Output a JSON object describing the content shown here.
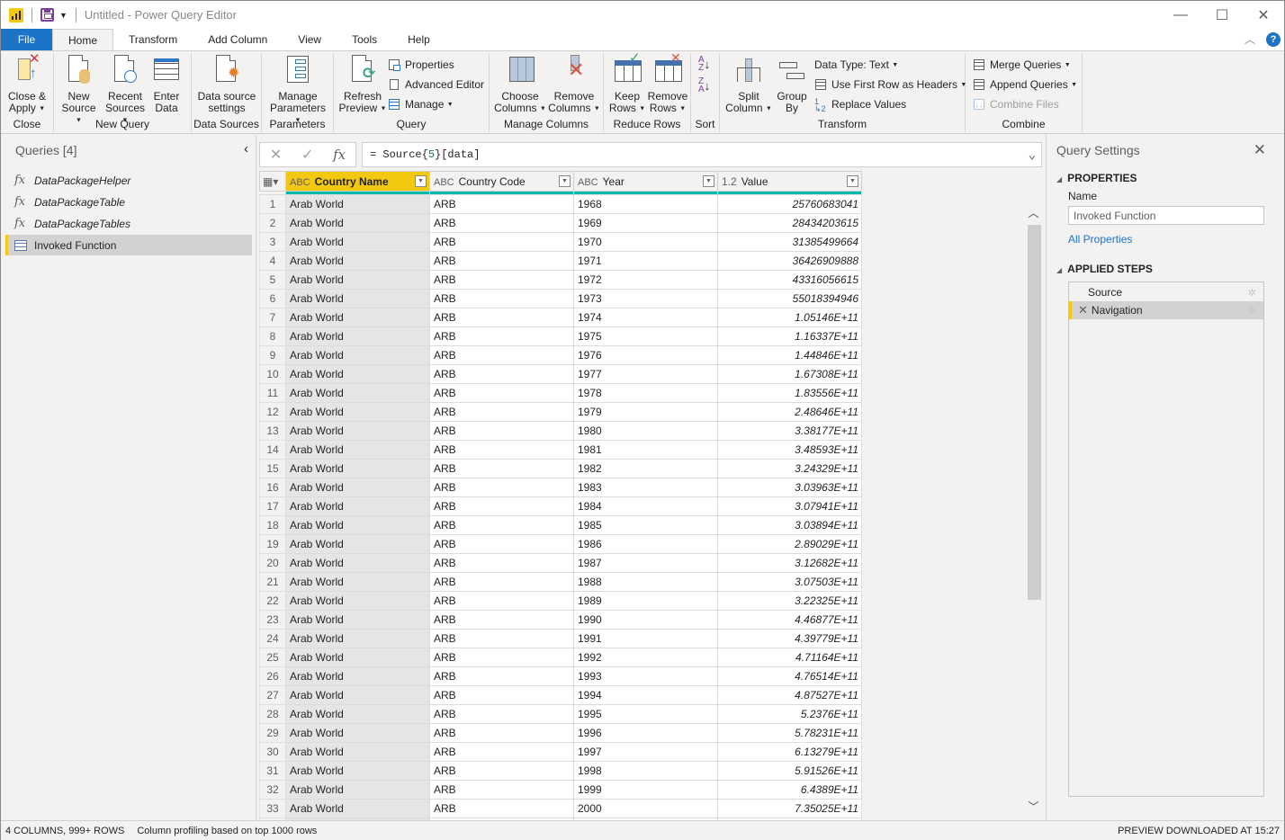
{
  "window": {
    "title": "Untitled - Power Query Editor",
    "app_icon": "powerbi-icon",
    "controls": {
      "minimize": "—",
      "maximize": "☐",
      "close": "✕"
    }
  },
  "tabs": [
    {
      "label": "File"
    },
    {
      "label": "Home",
      "active": true
    },
    {
      "label": "Transform"
    },
    {
      "label": "Add Column"
    },
    {
      "label": "View"
    },
    {
      "label": "Tools"
    },
    {
      "label": "Help"
    }
  ],
  "ribbon": {
    "close": {
      "label": "Close",
      "close_apply": [
        "Close &",
        "Apply"
      ]
    },
    "new_query": {
      "label": "New Query",
      "new_source": [
        "New",
        "Source"
      ],
      "recent_sources": [
        "Recent",
        "Sources"
      ],
      "enter_data": [
        "Enter",
        "Data"
      ]
    },
    "data_sources": {
      "label": "Data Sources",
      "settings": [
        "Data source",
        "settings"
      ]
    },
    "parameters": {
      "label": "Parameters",
      "manage": [
        "Manage",
        "Parameters"
      ]
    },
    "query": {
      "label": "Query",
      "refresh": [
        "Refresh",
        "Preview"
      ],
      "properties": "Properties",
      "advanced_editor": "Advanced Editor",
      "manage": "Manage"
    },
    "manage_columns": {
      "label": "Manage Columns",
      "choose": [
        "Choose",
        "Columns"
      ],
      "remove": [
        "Remove",
        "Columns"
      ]
    },
    "reduce_rows": {
      "label": "Reduce Rows",
      "keep": [
        "Keep",
        "Rows"
      ],
      "remove": [
        "Remove",
        "Rows"
      ]
    },
    "sort": {
      "label": "Sort"
    },
    "transform": {
      "label": "Transform",
      "split": [
        "Split",
        "Column"
      ],
      "group": [
        "Group",
        "By"
      ],
      "data_type": "Data Type: Text",
      "first_row": "Use First Row as Headers",
      "replace": "Replace Values"
    },
    "combine": {
      "label": "Combine",
      "merge": "Merge Queries",
      "append": "Append Queries",
      "combine_files": "Combine Files"
    }
  },
  "queries": {
    "title": "Queries [4]",
    "items": [
      {
        "label": "DataPackageHelper",
        "type": "function"
      },
      {
        "label": "DataPackageTable",
        "type": "function"
      },
      {
        "label": "DataPackageTables",
        "type": "function"
      },
      {
        "label": "Invoked Function",
        "type": "table",
        "selected": true
      }
    ]
  },
  "formula": {
    "prefix": "= Source{",
    "index": "5",
    "suffix": "}[data]"
  },
  "grid": {
    "columns": [
      {
        "type": "ABC",
        "name": "Country Name",
        "selected": true
      },
      {
        "type": "ABC",
        "name": "Country Code"
      },
      {
        "type": "ABC",
        "name": "Year"
      },
      {
        "type": "1.2",
        "name": "Value"
      }
    ],
    "rows": [
      [
        "Arab World",
        "ARB",
        "1968",
        "25760683041"
      ],
      [
        "Arab World",
        "ARB",
        "1969",
        "28434203615"
      ],
      [
        "Arab World",
        "ARB",
        "1970",
        "31385499664"
      ],
      [
        "Arab World",
        "ARB",
        "1971",
        "36426909888"
      ],
      [
        "Arab World",
        "ARB",
        "1972",
        "43316056615"
      ],
      [
        "Arab World",
        "ARB",
        "1973",
        "55018394946"
      ],
      [
        "Arab World",
        "ARB",
        "1974",
        "1.05146E+11"
      ],
      [
        "Arab World",
        "ARB",
        "1975",
        "1.16337E+11"
      ],
      [
        "Arab World",
        "ARB",
        "1976",
        "1.44846E+11"
      ],
      [
        "Arab World",
        "ARB",
        "1977",
        "1.67308E+11"
      ],
      [
        "Arab World",
        "ARB",
        "1978",
        "1.83556E+11"
      ],
      [
        "Arab World",
        "ARB",
        "1979",
        "2.48646E+11"
      ],
      [
        "Arab World",
        "ARB",
        "1980",
        "3.38177E+11"
      ],
      [
        "Arab World",
        "ARB",
        "1981",
        "3.48593E+11"
      ],
      [
        "Arab World",
        "ARB",
        "1982",
        "3.24329E+11"
      ],
      [
        "Arab World",
        "ARB",
        "1983",
        "3.03963E+11"
      ],
      [
        "Arab World",
        "ARB",
        "1984",
        "3.07941E+11"
      ],
      [
        "Arab World",
        "ARB",
        "1985",
        "3.03894E+11"
      ],
      [
        "Arab World",
        "ARB",
        "1986",
        "2.89029E+11"
      ],
      [
        "Arab World",
        "ARB",
        "1987",
        "3.12682E+11"
      ],
      [
        "Arab World",
        "ARB",
        "1988",
        "3.07503E+11"
      ],
      [
        "Arab World",
        "ARB",
        "1989",
        "3.22325E+11"
      ],
      [
        "Arab World",
        "ARB",
        "1990",
        "4.46877E+11"
      ],
      [
        "Arab World",
        "ARB",
        "1991",
        "4.39779E+11"
      ],
      [
        "Arab World",
        "ARB",
        "1992",
        "4.71164E+11"
      ],
      [
        "Arab World",
        "ARB",
        "1993",
        "4.76514E+11"
      ],
      [
        "Arab World",
        "ARB",
        "1994",
        "4.87527E+11"
      ],
      [
        "Arab World",
        "ARB",
        "1995",
        "5.2376E+11"
      ],
      [
        "Arab World",
        "ARB",
        "1996",
        "5.78231E+11"
      ],
      [
        "Arab World",
        "ARB",
        "1997",
        "6.13279E+11"
      ],
      [
        "Arab World",
        "ARB",
        "1998",
        "5.91526E+11"
      ],
      [
        "Arab World",
        "ARB",
        "1999",
        "6.4389E+11"
      ],
      [
        "Arab World",
        "ARB",
        "2000",
        "7.35025E+11"
      ]
    ]
  },
  "settings": {
    "title": "Query Settings",
    "properties_header": "PROPERTIES",
    "name_label": "Name",
    "name_value": "Invoked Function",
    "all_properties": "All Properties",
    "steps_header": "APPLIED STEPS",
    "steps": [
      {
        "label": "Source"
      },
      {
        "label": "Navigation",
        "selected": true
      }
    ]
  },
  "status": {
    "summary": "4 COLUMNS, 999+ ROWS",
    "profiling": "Column profiling based on top 1000 rows",
    "preview": "PREVIEW DOWNLOADED AT 15:27"
  }
}
